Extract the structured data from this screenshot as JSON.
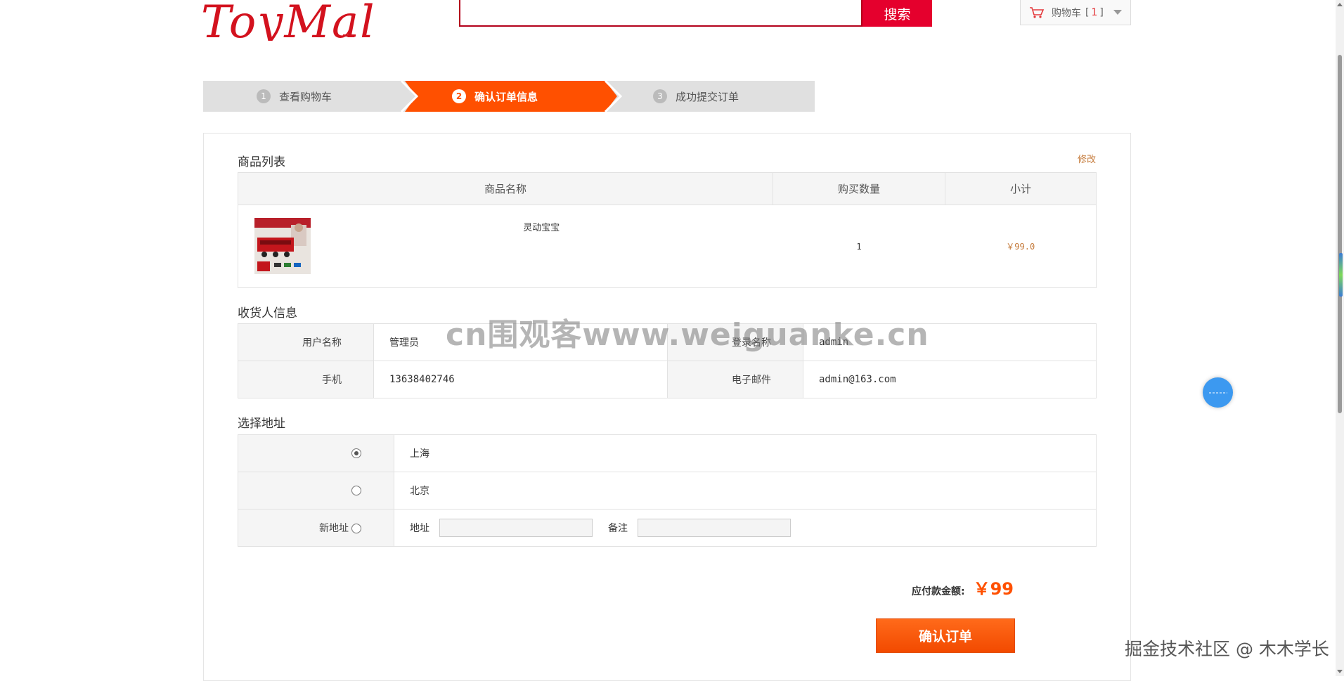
{
  "header": {
    "logo_text": "ToyMal",
    "search_placeholder": "",
    "search_button": "搜索",
    "cart_label": "购物车",
    "cart_open": "[",
    "cart_count": "1",
    "cart_close": "]"
  },
  "steps": [
    {
      "num": "1",
      "label": "查看购物车",
      "active": false
    },
    {
      "num": "2",
      "label": "确认订单信息",
      "active": true
    },
    {
      "num": "3",
      "label": "成功提交订单",
      "active": false
    }
  ],
  "goods": {
    "title": "商品列表",
    "edit_link": "修改",
    "headers": [
      "商品名称",
      "购买数量",
      "小计"
    ],
    "items": [
      {
        "name": "灵动宝宝",
        "qty": "1",
        "subtotal": "￥99.0"
      }
    ]
  },
  "receiver": {
    "title": "收货人信息",
    "user_name_label": "用户名称",
    "user_name": "管理员",
    "login_name_label": "登录名称",
    "login_name": "admin",
    "phone_label": "手机",
    "phone": "13638402746",
    "email_label": "电子邮件",
    "email": "admin@163.com"
  },
  "address": {
    "title": "选择地址",
    "options": [
      {
        "label": "上海",
        "checked": true
      },
      {
        "label": "北京",
        "checked": false
      }
    ],
    "new_label": "新地址",
    "addr_field_label": "地址",
    "note_field_label": "备注",
    "addr_value": "",
    "note_value": ""
  },
  "summary": {
    "total_label": "应付款金额:",
    "total_amount": "￥99",
    "confirm_button": "确认订单"
  },
  "overlay": {
    "watermark": "cn围观客www.weiguanke.cn",
    "corner_mark": "掘金技术社区 @ 木木学长"
  },
  "colors": {
    "brand_red": "#d3121e",
    "accent_orange": "#ff5000",
    "step_inactive": "#e0e0e0"
  }
}
